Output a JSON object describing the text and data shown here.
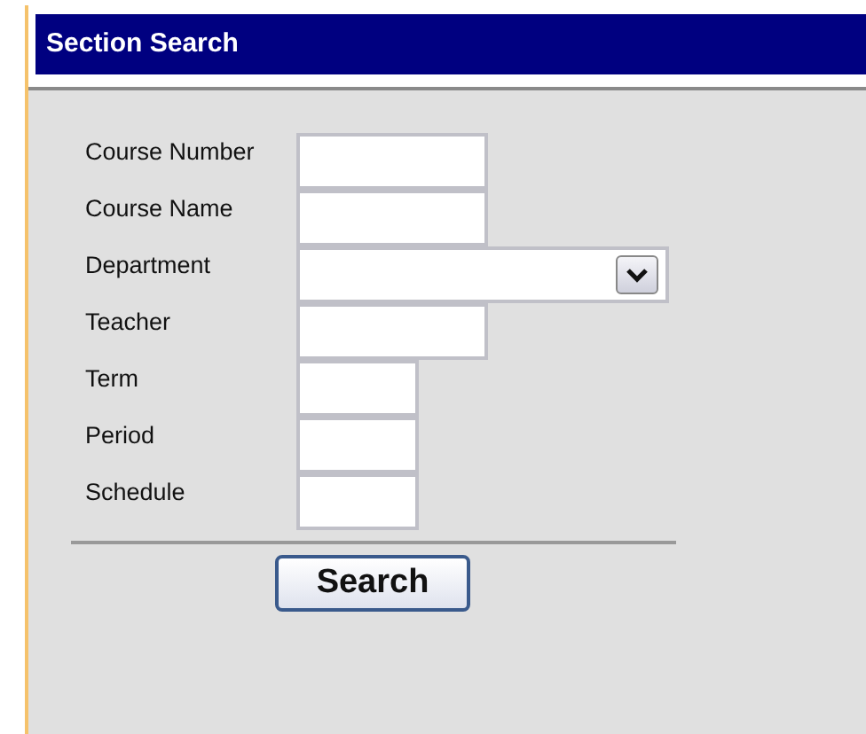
{
  "header": {
    "title": "Section Search"
  },
  "fields": [
    {
      "label": "Course Number",
      "kind": "text"
    },
    {
      "label": "Course Name",
      "kind": "text"
    },
    {
      "label": "Department",
      "kind": "select"
    },
    {
      "label": "Teacher",
      "kind": "text"
    },
    {
      "label": "Term",
      "kind": "short"
    },
    {
      "label": "Period",
      "kind": "short"
    },
    {
      "label": "Schedule",
      "kind": "short"
    }
  ],
  "button": "Search"
}
